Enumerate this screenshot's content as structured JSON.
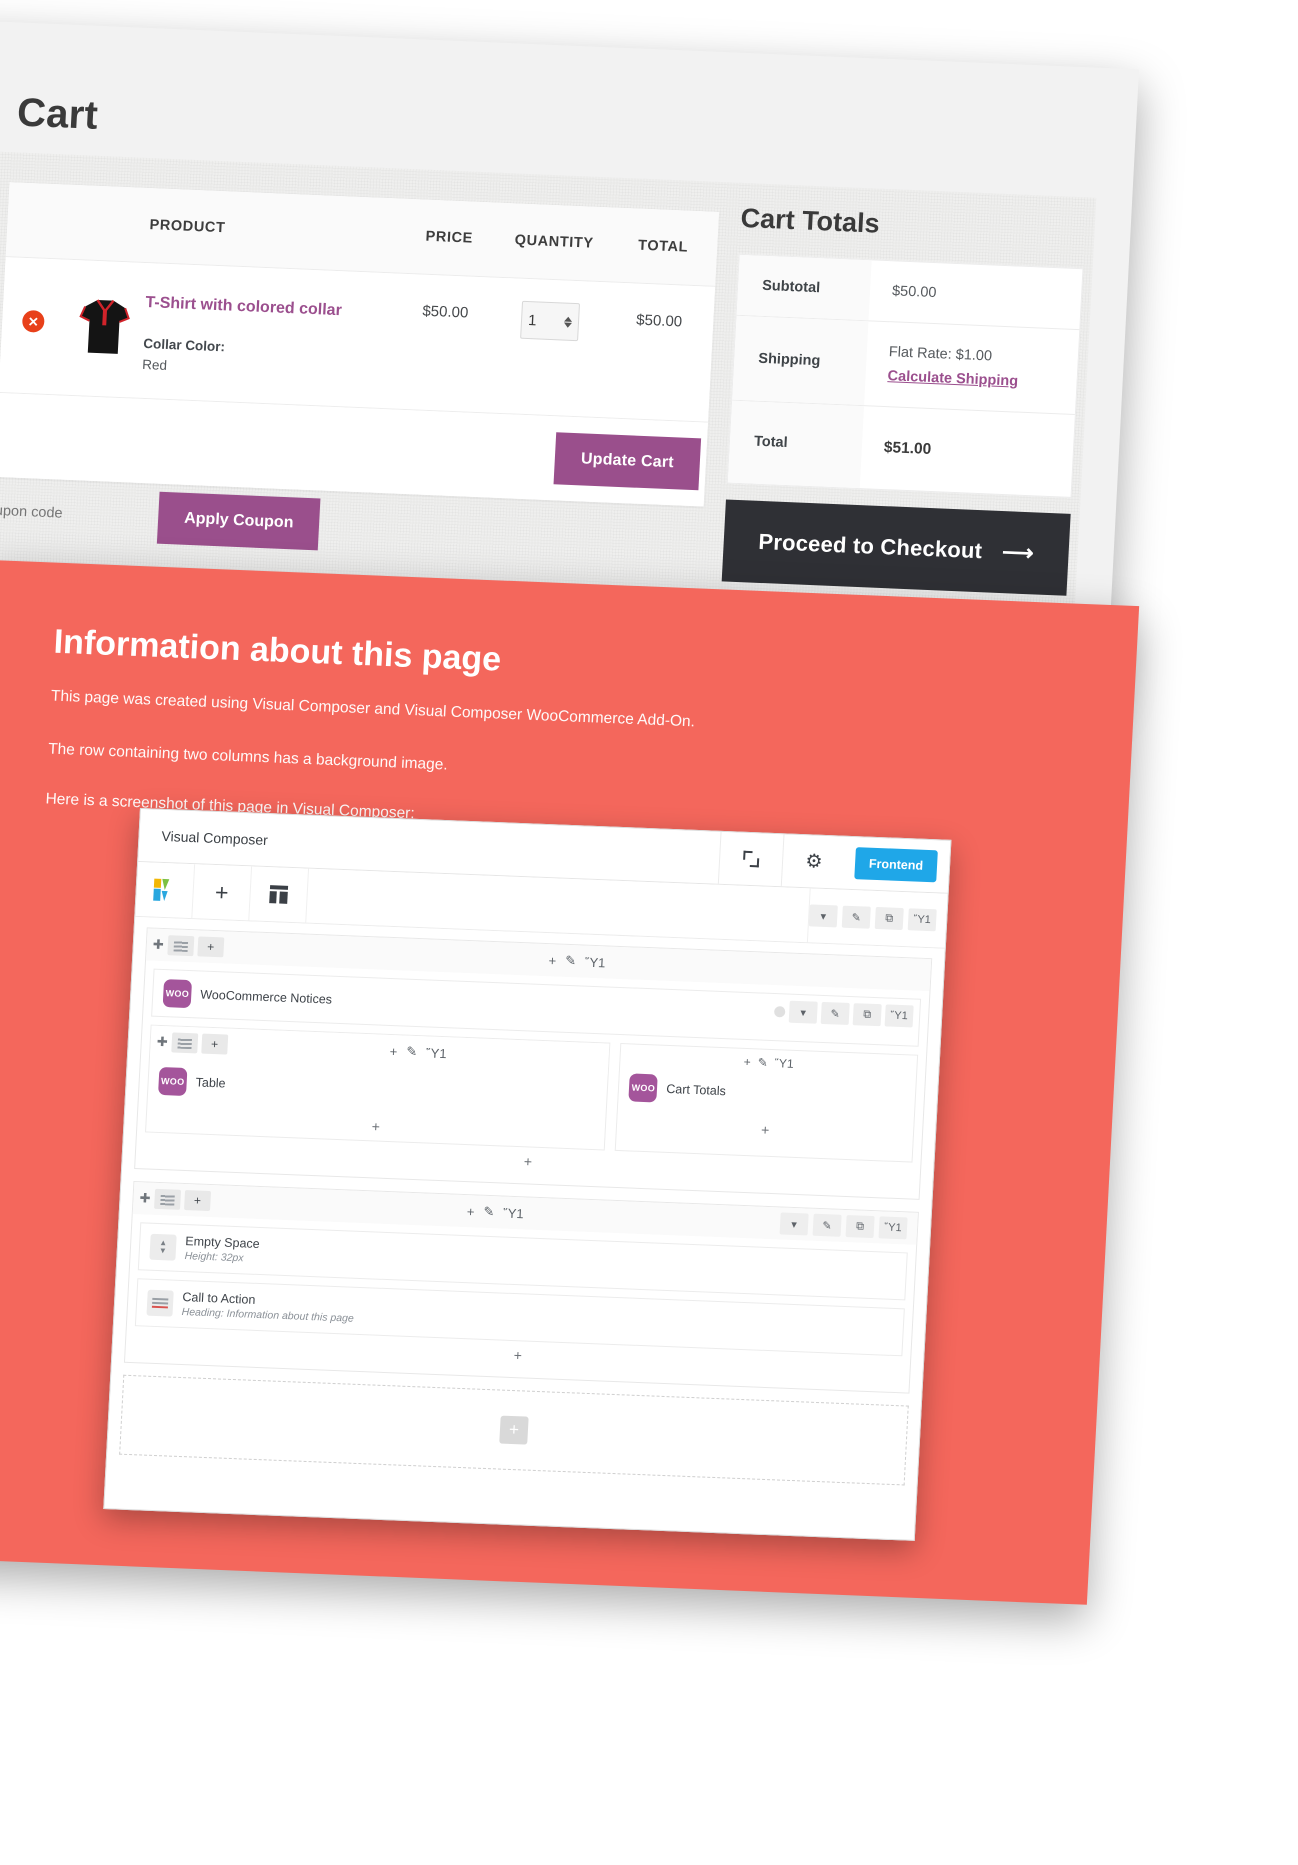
{
  "cart": {
    "page_title": "Cart",
    "headers": {
      "remove": "",
      "thumb": "",
      "product": "PRODUCT",
      "price": "PRICE",
      "quantity": "QUANTITY",
      "total": "TOTAL"
    },
    "items": [
      {
        "remove_icon": "remove-item-icon",
        "thumbnail": "tshirt-thumbnail",
        "name": "T-Shirt with colored collar",
        "meta_label": "Collar Color:",
        "meta_value": "Red",
        "price": "$50.00",
        "quantity": "1",
        "line_total": "$50.00"
      }
    ],
    "update_cart_label": "Update Cart",
    "coupon_placeholder": "Coupon code",
    "coupon_value": "",
    "apply_coupon_label": "Apply Coupon"
  },
  "totals": {
    "title": "Cart Totals",
    "rows": [
      {
        "label": "Subtotal",
        "value": "$50.00",
        "link": ""
      },
      {
        "label": "Shipping",
        "value": "Flat Rate: $1.00",
        "link": "Calculate Shipping"
      },
      {
        "label": "Total",
        "value": "$51.00",
        "link": ""
      }
    ],
    "checkout_label": "Proceed to Checkout",
    "checkout_arrow": "⟶"
  },
  "info": {
    "title": "Information about this page",
    "p1": "This page was created using Visual Composer and Visual Composer WooCommerce Add-On.",
    "p2": "The row containing two columns has a background image.",
    "p3": "Here is a screenshot of this page in Visual Composer:"
  },
  "vc": {
    "app_name": "Visual Composer",
    "frontend_label": "Frontend",
    "expand_icon": "expand-icon",
    "gear_icon": "gear-icon",
    "logo_icon": "visual-composer-logo",
    "add_element_icon": "plus-icon",
    "templates_icon": "layout-icon",
    "row_controls": [
      "▾",
      "✎",
      "⧉",
      "Ὕ1"
    ],
    "row_center_controls": [
      "+",
      "✎",
      "Ὕ1"
    ],
    "elements": {
      "notices": {
        "badge": "WOO",
        "name": "WooCommerce Notices"
      },
      "table": {
        "badge": "WOO",
        "name": "Table"
      },
      "cart_totals": {
        "badge": "WOO",
        "name": "Cart Totals"
      },
      "empty_space": {
        "name": "Empty Space",
        "sub": "Height: 32px"
      },
      "call_to_action": {
        "name": "Call to Action",
        "sub": "Heading: Information about this page"
      }
    },
    "plus_label": "+",
    "collapse_caret": "▲"
  },
  "colors": {
    "accent_purple": "#9a4f8c",
    "coral": "#f4675c",
    "checkout_dark": "#2f3035",
    "woo_purple": "#a4559b",
    "frontend_blue": "#1fa7e8",
    "remove_red": "#e8401a"
  }
}
